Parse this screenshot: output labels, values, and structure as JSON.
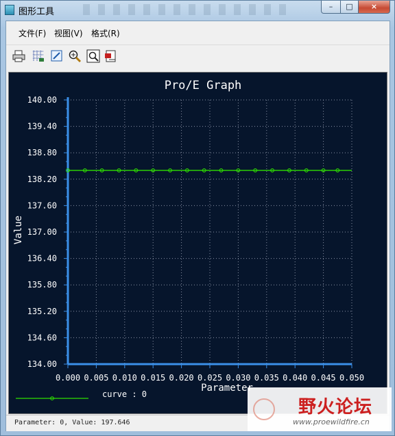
{
  "window": {
    "title": "图形工具",
    "controls": {
      "minimize": "–",
      "maximize": "□",
      "close": "×"
    }
  },
  "menu": [
    "文件(F)",
    "视图(V)",
    "格式(R)"
  ],
  "toolbar": [
    "print-icon",
    "grid-icon",
    "edit-icon",
    "zoom-in-icon",
    "zoom-fit-icon",
    "export-icon"
  ],
  "chart_data": {
    "type": "line",
    "title": "Pro/E Graph",
    "xlabel": "Parameter",
    "ylabel": "Value",
    "xlim": [
      0.0,
      0.05
    ],
    "ylim": [
      134.0,
      140.0
    ],
    "x_ticks": [
      "0.000",
      "0.005",
      "0.010",
      "0.015",
      "0.020",
      "0.025",
      "0.030",
      "0.035",
      "0.040",
      "0.045",
      "0.050"
    ],
    "y_ticks": [
      "140.00",
      "139.40",
      "138.80",
      "138.20",
      "137.60",
      "137.00",
      "136.40",
      "135.80",
      "135.20",
      "134.60",
      "134.00"
    ],
    "grid": true,
    "legend_position": "bottom-left",
    "series": [
      {
        "name": "curve : 0",
        "color": "#2fe000",
        "x": [
          0.0,
          0.003,
          0.006,
          0.009,
          0.012,
          0.015,
          0.018,
          0.021,
          0.024,
          0.027,
          0.03,
          0.033,
          0.036,
          0.039,
          0.042,
          0.045,
          0.0475,
          0.05
        ],
        "y": [
          138.4,
          138.4,
          138.4,
          138.4,
          138.4,
          138.4,
          138.4,
          138.4,
          138.4,
          138.4,
          138.4,
          138.4,
          138.4,
          138.4,
          138.4,
          138.4,
          138.4,
          138.4
        ],
        "markers_x": [
          0.0,
          0.003,
          0.006,
          0.009,
          0.012,
          0.015,
          0.018,
          0.021,
          0.024,
          0.027,
          0.03,
          0.033,
          0.036,
          0.039,
          0.042,
          0.045,
          0.0475
        ]
      }
    ],
    "colors": {
      "background": "#06152c",
      "axis": "#3b8fe8",
      "grid": "#8a93a6",
      "text": "#ffffff",
      "series": "#2fe000"
    }
  },
  "status": "Parameter: 0, Value: 197.646",
  "watermark": {
    "text": "野火论坛",
    "url": "www.proewildfire.cn"
  }
}
